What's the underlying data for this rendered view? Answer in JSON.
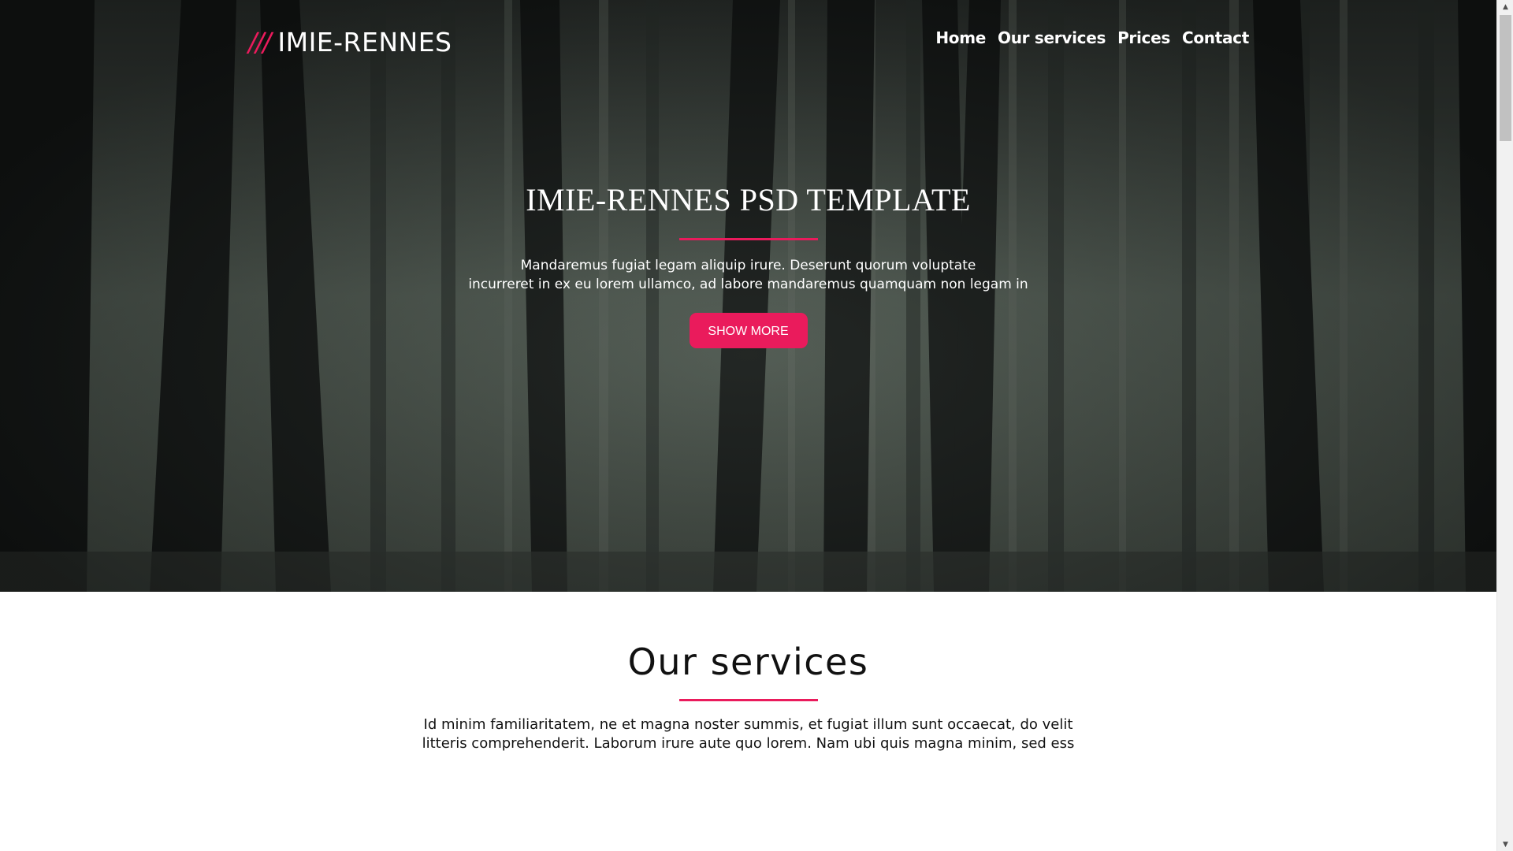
{
  "brand": {
    "slashes": "///",
    "name": "IMIE-RENNES"
  },
  "nav": {
    "items": [
      {
        "label": "Home"
      },
      {
        "label": "Our services"
      },
      {
        "label": "Prices"
      },
      {
        "label": "Contact"
      }
    ]
  },
  "hero": {
    "title": "IMIE-RENNES PSD TEMPLATE",
    "text_line1": "Mandaremus fugiat legam aliquip irure. Deserunt quorum voluptate",
    "text_line2": "incurreret in ex eu lorem ullamco, ad labore mandaremus quamquam non legam in",
    "button_label": "SHOW MORE",
    "background": "forest-image"
  },
  "services": {
    "title": "Our services",
    "text_line1": "Id minim familiaritatem, ne et magna noster summis, et fugiat illum sunt occaecat, do velit",
    "text_line2": "litteris comprehenderit. Laborum irure aute quo lorem. Nam ubi quis magna minim, sed ess"
  },
  "colors": {
    "accent": "#ea1b5c",
    "text_light": "#ffffff",
    "text_dark": "#111111"
  },
  "scrollbar": {
    "up_icon": "arrow-up-icon",
    "down_icon": "arrow-down-icon"
  }
}
